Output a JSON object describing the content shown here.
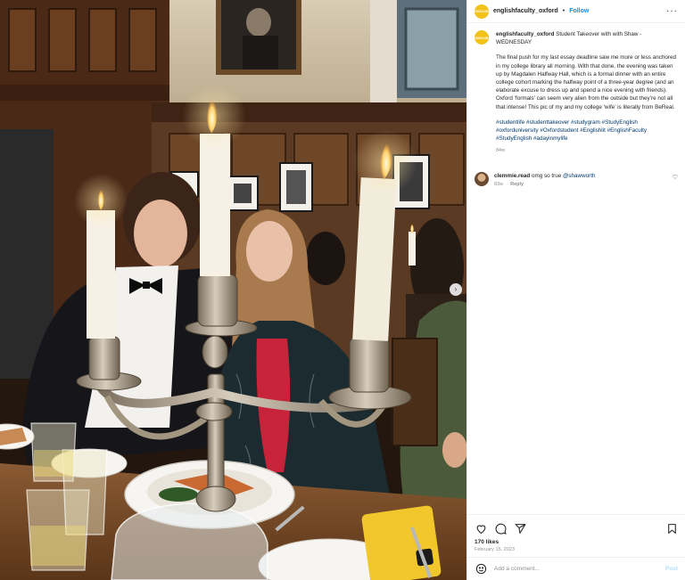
{
  "post": {
    "author": {
      "username": "englishfaculty_oxford",
      "avatar_text": "ENGLISH",
      "avatar_color": "#f2c21b"
    },
    "header": {
      "separator": "•",
      "follow_label": "Follow",
      "more_icon": "more-horizontal-icon"
    },
    "caption": {
      "username": "englishfaculty_oxford",
      "title": "Student Takeover with with Shaw - WEDNESDAY",
      "text": "The final push for my last essay deadline saw me more or less anchored in my college library all morning. With that done, the evening was taken up by Magdalen Halfway Hall, which is a formal dinner with an entire college cohort marking the halfway point of a three-year degree (and an elaborate excuse to dress up and spend a nice evening with friends). Oxford ‘formals’ can seem very alien from the outside but they’re not all that intense! This pic of my and my college ‘wife’ is literally from BeReal.",
      "hashtags": "#studentlife #studenttakeover #studygram #StudyEnglish #oxforduniversity #Oxfordstudent #Englishlit #EnglishFaculty #StudyEnglish #adayinmylife",
      "age": "84w"
    },
    "comments": [
      {
        "username": "clemmie.read",
        "text": "omg so true",
        "mention": "@shawworth",
        "age": "83w",
        "reply_label": "Reply"
      }
    ],
    "actions": {
      "like_icon": "heart-icon",
      "comment_icon": "comment-icon",
      "share_icon": "share-icon",
      "save_icon": "bookmark-icon"
    },
    "likes_label": "170 likes",
    "date": "February 15, 2023",
    "add_comment": {
      "placeholder": "Add a comment...",
      "post_label": "Post",
      "emoji_icon": "emoji-icon"
    },
    "carousel": {
      "next_icon": "chevron-right-icon"
    },
    "accent_color": "#0095f6"
  }
}
